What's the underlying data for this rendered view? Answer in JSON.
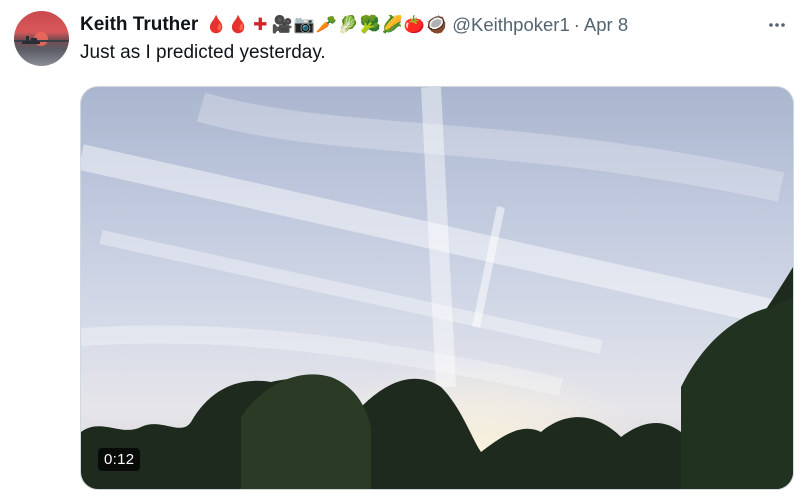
{
  "tweet": {
    "author": {
      "display_name": "Keith Truther",
      "handle": "@Keithpoker1",
      "emojis": [
        "🩸",
        "🩸",
        "✚",
        "🎥",
        "📷",
        "🥕",
        "🥬",
        "🥦",
        "🌽",
        "🍅",
        "🥥"
      ],
      "emoji_colors": [
        "#c3182f",
        "#c3182f",
        "#d1232a",
        "#3a3a3a",
        "#2f3b46",
        "#f08a1f",
        "#4fa43a",
        "#2f7d2b",
        "#e9b21c",
        "#d7262a",
        "#7a4b2a"
      ]
    },
    "separator": "·",
    "date": "Apr 8",
    "text": "Just as I predicted yesterday.",
    "media": {
      "type": "video",
      "duration": "0:12"
    }
  },
  "icons": {
    "more": "more-horizontal-icon"
  }
}
